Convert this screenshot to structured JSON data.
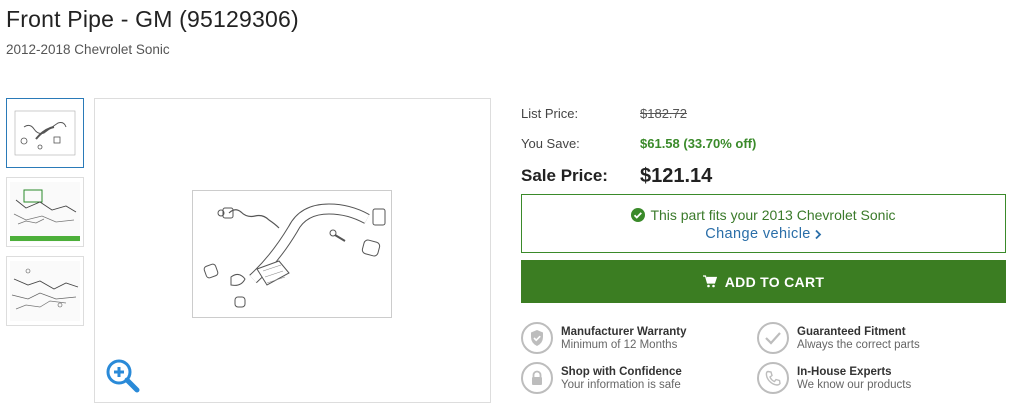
{
  "product": {
    "title": "Front Pipe - GM (95129306)",
    "subtitle": "2012-2018 Chevrolet Sonic"
  },
  "gallery": {
    "thumbnail_count": 3,
    "active_thumbnail": 0,
    "zoom_icon": "zoom-in-icon"
  },
  "pricing": {
    "list_label": "List Price:",
    "list_value": "$182.72",
    "save_label": "You Save:",
    "save_value": "$61.58 (33.70% off)",
    "sale_label": "Sale Price:",
    "sale_value": "$121.14"
  },
  "fitment": {
    "message": "This part fits your 2013 Chevrolet Sonic",
    "change_label": "Change vehicle",
    "icon": "check-circle-icon"
  },
  "cart": {
    "label": "ADD TO CART",
    "icon": "cart-icon"
  },
  "features": [
    {
      "title": "Manufacturer Warranty",
      "subtitle": "Minimum of 12 Months",
      "icon": "shield-check-icon"
    },
    {
      "title": "Guaranteed Fitment",
      "subtitle": "Always the correct parts",
      "icon": "checkmark-icon"
    },
    {
      "title": "Shop with Confidence",
      "subtitle": "Your information is safe",
      "icon": "lock-icon"
    },
    {
      "title": "In-House Experts",
      "subtitle": "We know our products",
      "icon": "phone-icon"
    }
  ],
  "colors": {
    "accent_green": "#3b7d22",
    "savings_green": "#3a8a2a",
    "link_blue": "#2a6ea8",
    "active_border": "#2a7ab8"
  }
}
